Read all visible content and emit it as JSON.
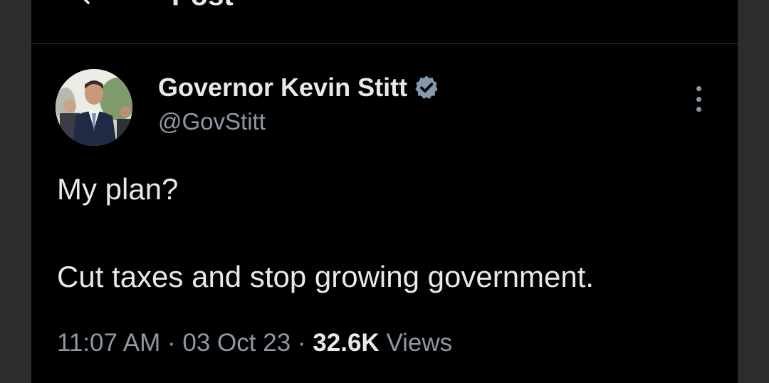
{
  "header": {
    "title": "Post"
  },
  "author": {
    "display_name": "Governor Kevin Stitt",
    "handle": "@GovStitt",
    "verified": true
  },
  "post": {
    "lines": [
      "My plan?",
      "Cut taxes and stop growing government."
    ],
    "time": "11:07 AM",
    "separator": "·",
    "date": "03 Oct 23",
    "views_count": "32.6K",
    "views_label": "Views"
  },
  "colors": {
    "background": "#000000",
    "outer_background": "#2b2c2e",
    "primary_text": "#e7e9ea",
    "secondary_text": "#8b98a5",
    "verified_badge": "#829aab"
  },
  "icons": {
    "back": "arrow-left-icon",
    "verified": "verified-badge-icon",
    "more": "more-vertical-icon"
  }
}
